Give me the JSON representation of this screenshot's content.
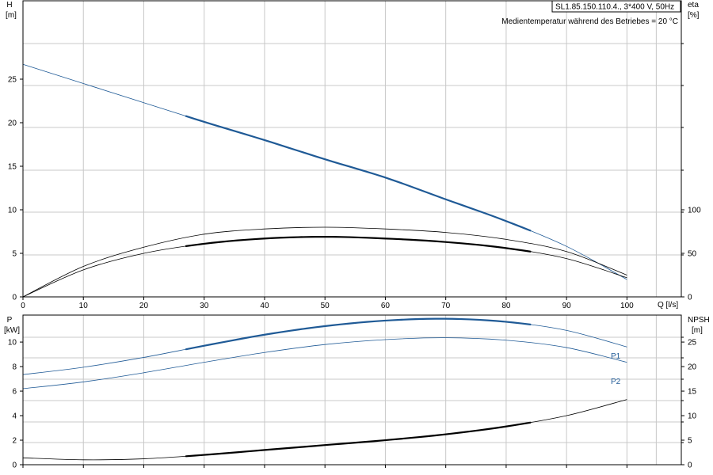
{
  "info": {
    "model": "SL1.85.150.110.4., 3*400 V, 50Hz",
    "medium": "Medientemperatur während des Betriebes = 20 °C"
  },
  "colors": {
    "blue": "#1f5a96",
    "black": "#000000",
    "grid": "#c8c8c8"
  },
  "chart_data": [
    {
      "type": "line",
      "title": "",
      "xlabel": "Q [l/s]",
      "xticks": [
        0,
        10,
        20,
        30,
        40,
        50,
        60,
        70,
        80,
        90,
        100
      ],
      "xlim": [
        0,
        109
      ],
      "ylabel_left": "H",
      "ylabel_left_unit": "[m]",
      "ylim_left": [
        0,
        34
      ],
      "yticks_left": [
        0,
        5,
        10,
        15,
        20,
        25
      ],
      "ylabel_right": "eta",
      "ylabel_right_unit": "[%]",
      "ylim_right": [
        0,
        340
      ],
      "yticks_right": [
        0,
        50,
        100
      ],
      "grid": true,
      "series": [
        {
          "axis": "left",
          "color": "blue",
          "x": [
            0,
            10,
            20,
            30,
            40,
            50,
            60,
            70,
            80,
            90,
            100
          ],
          "y": [
            26.7,
            24.5,
            22.3,
            20.1,
            18.0,
            15.8,
            13.7,
            11.2,
            8.7,
            5.8,
            2.0
          ],
          "highlight": [
            27,
            84
          ]
        },
        {
          "axis": "right",
          "color": "black",
          "x": [
            0,
            10,
            20,
            30,
            40,
            50,
            60,
            70,
            80,
            90,
            100
          ],
          "y": [
            0,
            35,
            57,
            72,
            78,
            80,
            78,
            74,
            66,
            52,
            25
          ],
          "highlight": null
        },
        {
          "axis": "right",
          "color": "black",
          "x": [
            0,
            10,
            20,
            30,
            40,
            50,
            60,
            70,
            80,
            90,
            100
          ],
          "y": [
            0,
            31,
            50,
            61,
            67,
            69,
            67,
            63,
            56,
            44,
            22
          ],
          "highlight": [
            27,
            84
          ]
        }
      ]
    },
    {
      "type": "line",
      "title": "",
      "xlim": [
        0,
        109
      ],
      "ylabel_left": "P",
      "ylabel_left_unit": "[kW]",
      "ylim_left": [
        0,
        12.2
      ],
      "yticks_left": [
        0,
        2,
        4,
        6,
        8,
        10
      ],
      "ylabel_right": "NPSH",
      "ylabel_right_unit": "[m]",
      "ylim_right": [
        0,
        30.5
      ],
      "yticks_right": [
        0,
        5,
        10,
        15,
        20,
        25
      ],
      "grid": true,
      "series": [
        {
          "name": "P1",
          "axis": "left",
          "color": "blue",
          "x": [
            0,
            10,
            20,
            30,
            40,
            50,
            60,
            70,
            80,
            90,
            100
          ],
          "y": [
            7.35,
            7.95,
            8.75,
            9.7,
            10.6,
            11.3,
            11.75,
            11.9,
            11.65,
            10.95,
            9.6
          ],
          "highlight": [
            27,
            84
          ]
        },
        {
          "name": "P2",
          "axis": "left",
          "color": "blue",
          "x": [
            0,
            10,
            20,
            30,
            40,
            50,
            60,
            70,
            80,
            90,
            100
          ],
          "y": [
            6.2,
            6.75,
            7.5,
            8.35,
            9.15,
            9.8,
            10.2,
            10.35,
            10.15,
            9.55,
            8.35
          ],
          "highlight": null
        },
        {
          "axis": "right",
          "color": "black",
          "x": [
            0,
            10,
            20,
            30,
            40,
            50,
            60,
            70,
            80,
            90,
            100
          ],
          "y": [
            1.4,
            1.0,
            1.2,
            2.0,
            3.0,
            4.0,
            5.0,
            6.2,
            7.8,
            10.0,
            13.3
          ],
          "highlight": [
            27,
            84
          ]
        }
      ]
    }
  ]
}
